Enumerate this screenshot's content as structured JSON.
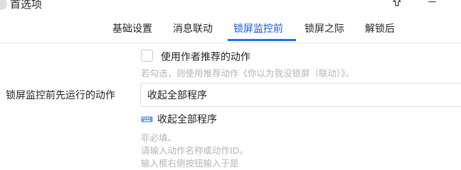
{
  "window": {
    "title": "首选项"
  },
  "tabs": [
    {
      "label": "基础设置",
      "active": false
    },
    {
      "label": "消息联动",
      "active": false
    },
    {
      "label": "锁屏监控前",
      "active": true
    },
    {
      "label": "锁屏之际",
      "active": false
    },
    {
      "label": "解锁后",
      "active": false
    }
  ],
  "option": {
    "checkbox_label": "使用作者推荐的动作",
    "checked": false,
    "hint": "若勾选，则使用推荐动作《你以为我没锁屏（联动）》。"
  },
  "action": {
    "label": "锁屏监控前先运行的动作",
    "value": "收起全部程序",
    "suggestion": "收起全部程序",
    "suggestion_icon": "keyboard-icon",
    "hints": [
      "非必填。",
      "请输入动作名称或动作ID。",
      "输入框右侧按钮输入于是"
    ]
  },
  "colors": {
    "accent": "#1a73e8",
    "active_tab_text": "#1557c9",
    "hint_text": "#b4b4b4"
  }
}
